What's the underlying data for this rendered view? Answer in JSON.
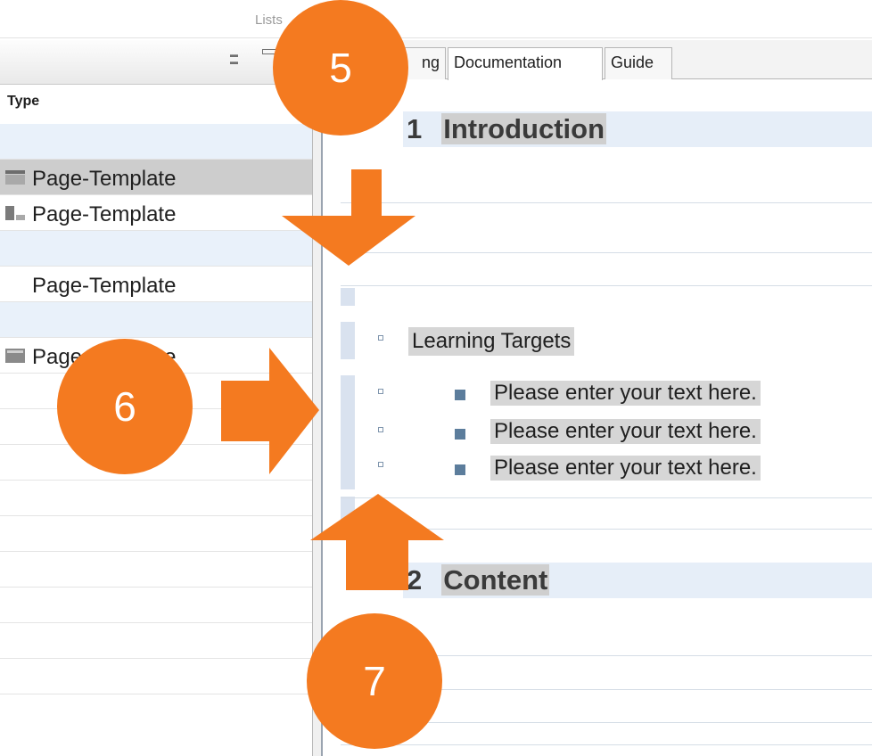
{
  "ribbon": {
    "group_label": "Lists"
  },
  "left_panel": {
    "column_header": "Type",
    "rows": [
      {
        "label": "",
        "style": "shade",
        "icon": ""
      },
      {
        "label": "Page-Template",
        "style": "selected",
        "icon": "page-template-icon"
      },
      {
        "label": "Page-Template",
        "style": "plain",
        "icon": "page-template-icon"
      },
      {
        "label": "",
        "style": "shade",
        "icon": ""
      },
      {
        "label": "Page-Template",
        "style": "plain",
        "icon": ""
      },
      {
        "label": "",
        "style": "shade",
        "icon": ""
      },
      {
        "label": "Page-Template",
        "style": "plain",
        "icon": "page-template-icon"
      }
    ]
  },
  "tabs": [
    {
      "label": "ng",
      "active": false
    },
    {
      "label": "Documentation",
      "active": true
    },
    {
      "label": "Guide",
      "active": false
    }
  ],
  "document": {
    "heading1": {
      "number": "1",
      "text": "Introduction"
    },
    "list_title": "Learning Targets",
    "items": [
      "Please enter your text here.",
      "Please enter your text here.",
      "Please enter your text here."
    ],
    "heading2": {
      "number": "2",
      "text": "Content"
    }
  },
  "callouts": [
    "5",
    "6",
    "7"
  ],
  "colors": {
    "callout": "#f47a20",
    "heading_band": "#e6eef8",
    "bullet": "#5c7d9c"
  }
}
